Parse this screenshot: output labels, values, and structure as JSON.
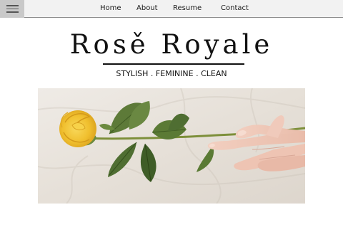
{
  "nav": {
    "menu_icon": "hamburger-menu-icon",
    "links": {
      "home": "Home",
      "about": "About",
      "resume": "Resume",
      "contact": "Contact"
    }
  },
  "brand": {
    "title": "Rosě Royale",
    "tagline": "STYLISH . FEMININE . CLEAN"
  },
  "hero": {
    "subject": "yellow-rose-held-by-hand-on-white-sheet"
  },
  "colors": {
    "nav_background": "#f2f2f2",
    "menu_button": "#c9c9c9",
    "text": "#111111",
    "rose": "#f3c93c",
    "leaf": "#4f6e32",
    "sheet": "#ece7e1"
  }
}
